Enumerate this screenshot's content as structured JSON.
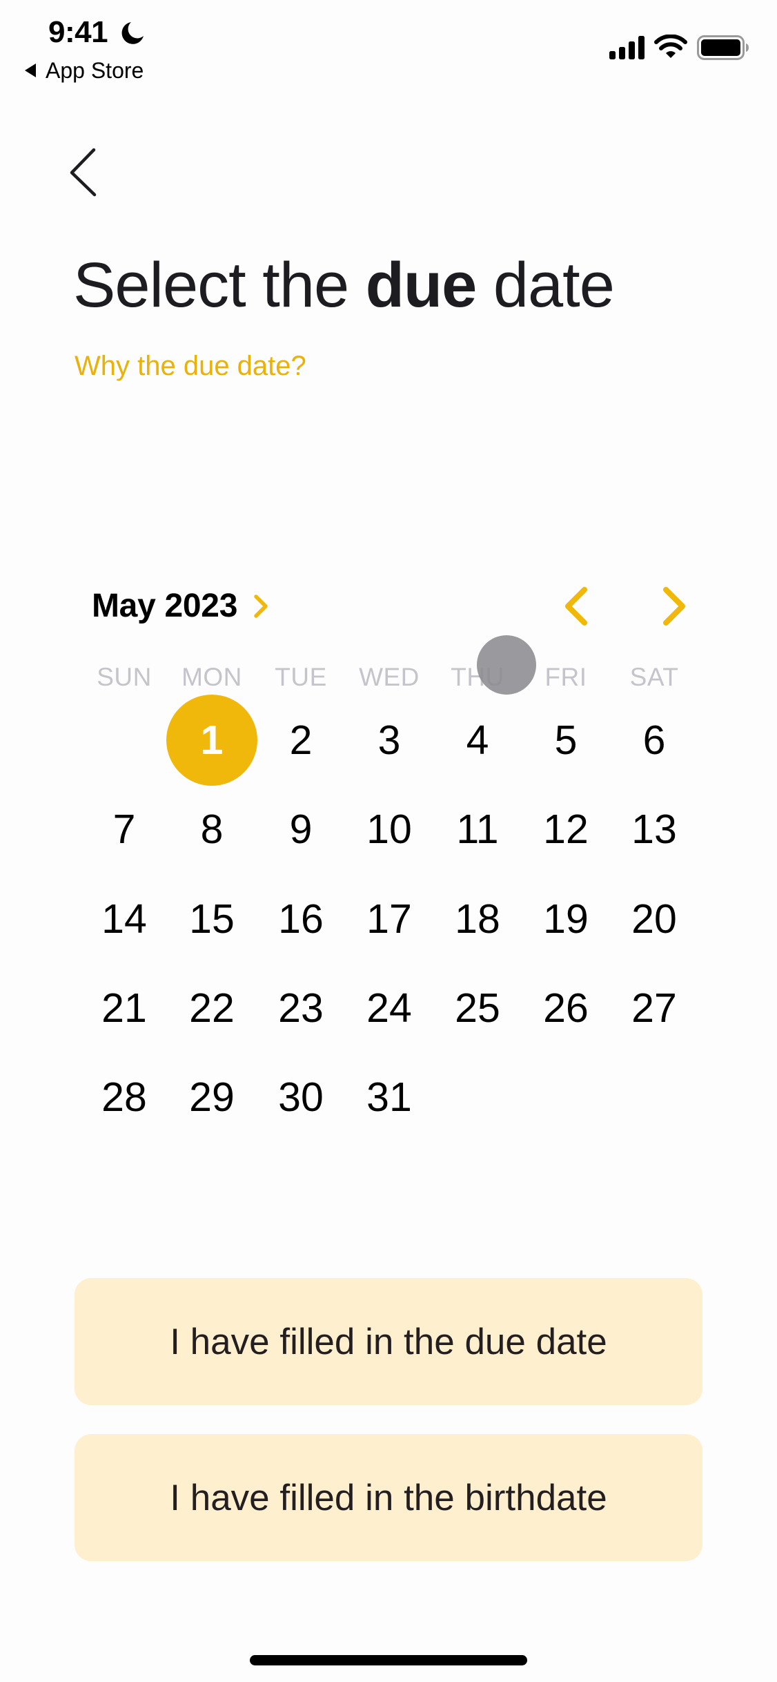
{
  "status_bar": {
    "time": "9:41",
    "focus_icon": "moon-icon",
    "back_app_label": "App Store",
    "icons": [
      "cellular-signal-icon",
      "wifi-icon",
      "battery-icon"
    ]
  },
  "nav": {
    "back_icon": "chevron-left-icon"
  },
  "header": {
    "title_prefix": "Select the ",
    "title_bold": "due",
    "title_suffix": " date",
    "help_link": "Why the due date?"
  },
  "calendar": {
    "month_label": "May 2023",
    "month_picker_icon": "chevron-right-icon",
    "prev_month_icon": "chevron-left-icon",
    "next_month_icon": "chevron-right-icon",
    "weekdays": [
      "SUN",
      "MON",
      "TUE",
      "WED",
      "THU",
      "FRI",
      "SAT"
    ],
    "first_weekday_index": 1,
    "days_in_month": 31,
    "selected_day": 1,
    "colors": {
      "accent": "#efb80b",
      "weekday_label": "#c4c4ca"
    }
  },
  "actions": {
    "filled_due_date": "I have filled in the due date",
    "filled_birthdate": "I have filled in the birthdate",
    "button_bg": "#feefcf"
  },
  "link_color": "#e9b10a"
}
